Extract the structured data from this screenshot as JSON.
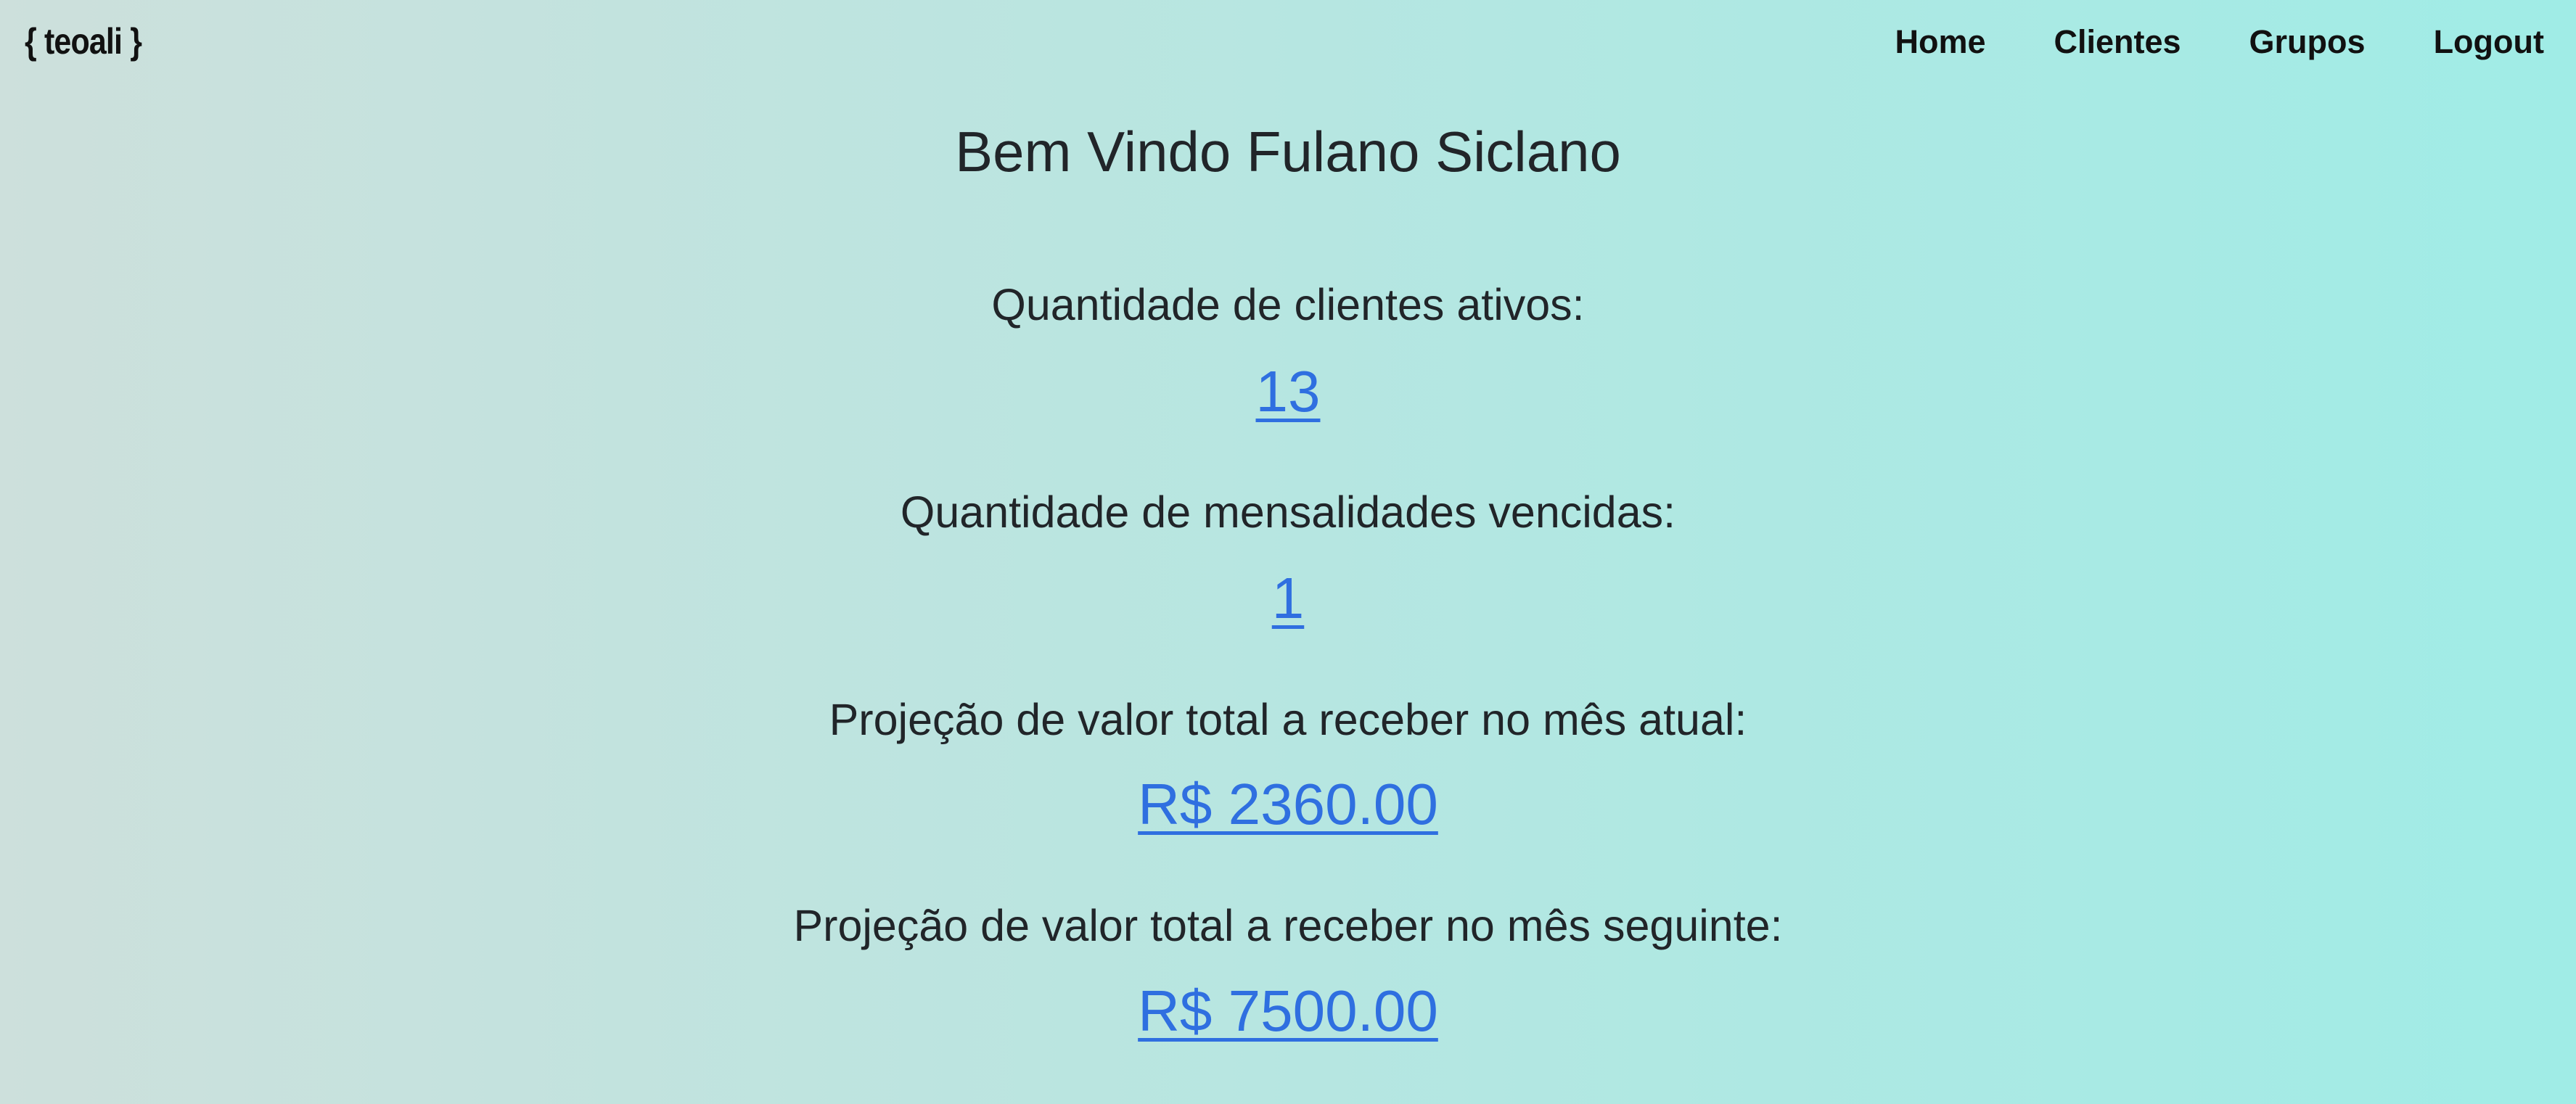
{
  "navbar": {
    "brand": "{ teoali }",
    "links": [
      "Home",
      "Clientes",
      "Grupos",
      "Logout"
    ]
  },
  "main": {
    "welcome": "Bem Vindo Fulano Siclano",
    "stats": [
      {
        "label": "Quantidade de clientes ativos:",
        "value": "13"
      },
      {
        "label": "Quantidade de mensalidades vencidas:",
        "value": "1"
      },
      {
        "label": "Projeção de valor total a receber no mês atual:",
        "value": "R$ 2360.00"
      },
      {
        "label": "Projeção de valor total a receber no mês seguinte:",
        "value": "R$ 7500.00"
      }
    ]
  },
  "colors": {
    "link": "#2f6fe0",
    "text": "#212529",
    "gradient_start": "#cde0dc",
    "gradient_end": "#a0ece6"
  }
}
